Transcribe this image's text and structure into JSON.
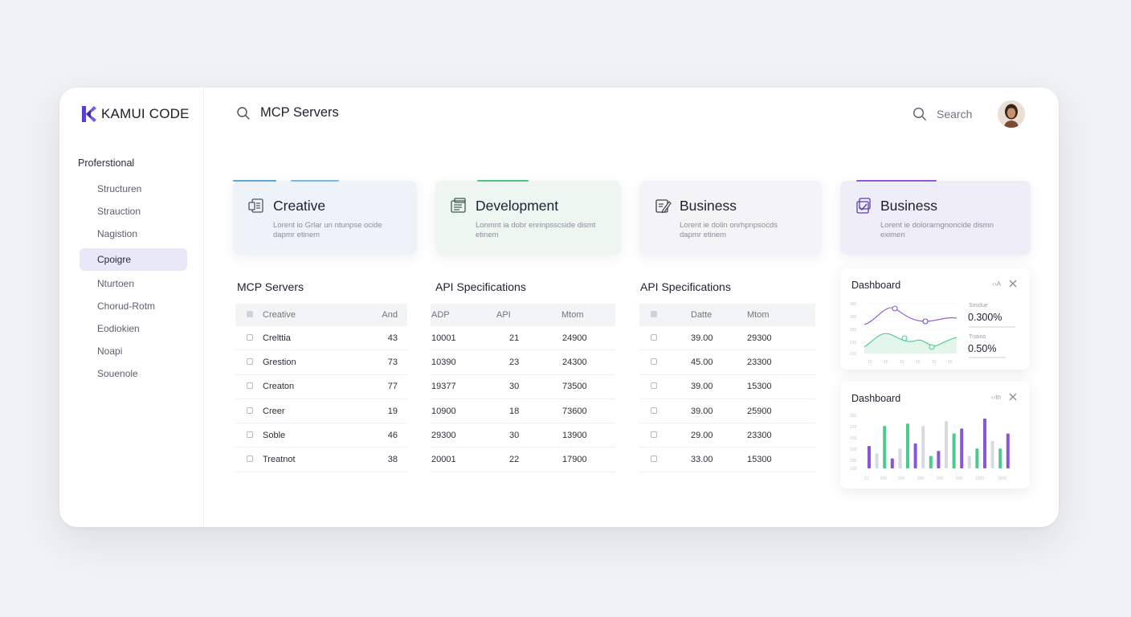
{
  "brand": {
    "name": "KAMUI CODE"
  },
  "sidebar": {
    "section": "Proferstional",
    "items": [
      {
        "label": "Structuren",
        "active": false
      },
      {
        "label": "Strauction",
        "active": false
      },
      {
        "label": "Nagistion",
        "active": false
      },
      {
        "label": "Cpoigre",
        "active": true
      },
      {
        "label": "Nturtoen",
        "active": false
      },
      {
        "label": "Chorud-Rotm",
        "active": false
      },
      {
        "label": "Eodiokien",
        "active": false
      },
      {
        "label": "Noapi",
        "active": false
      },
      {
        "label": "Souenole",
        "active": false
      }
    ]
  },
  "header": {
    "title": "MCP Servers",
    "search_label": "Search"
  },
  "cards": [
    {
      "title": "Creative",
      "desc": "Lorent io Grlar un ntunpse ocide dapmr etinem",
      "color": "#5aa6e0"
    },
    {
      "title": "Development",
      "desc": "Lonmnt ia dobr enrinpsscside dismt etinem",
      "color": "#4fc38a"
    },
    {
      "title": "Business",
      "desc": "Lorent ie dolin onrhpnpsocds dapmr etinem",
      "color": "#c9cbd2"
    },
    {
      "title": "Business",
      "desc": "Lorent ie dolorarngnoncide dismn eximen",
      "color": "#8e5ad8"
    }
  ],
  "tables": [
    {
      "title": "MCP Servers",
      "headers": [
        "",
        "Creative",
        "And"
      ],
      "rows": [
        [
          "",
          "Crelttia",
          "43"
        ],
        [
          "",
          "Grestion",
          "73"
        ],
        [
          "",
          "Creaton",
          "77"
        ],
        [
          "",
          "Creer",
          "19"
        ],
        [
          "",
          "Soble",
          "46"
        ],
        [
          "",
          "Treatnot",
          "38"
        ]
      ]
    },
    {
      "title": "API Specifications",
      "headers": [
        "ADP",
        "API",
        "Mtom"
      ],
      "rows": [
        [
          "10001",
          "21",
          "24900"
        ],
        [
          "10390",
          "23",
          "24300"
        ],
        [
          "19377",
          "30",
          "73500"
        ],
        [
          "10900",
          "18",
          "73600"
        ],
        [
          "29300",
          "30",
          "13900"
        ],
        [
          "20001",
          "22",
          "17900"
        ]
      ]
    },
    {
      "title": "API Specifications",
      "headers": [
        "",
        "Datte",
        "Mtom"
      ],
      "rows": [
        [
          "",
          "39.00",
          "29300"
        ],
        [
          "",
          "45.00",
          "23300"
        ],
        [
          "",
          "39.00",
          "15300"
        ],
        [
          "",
          "39.00",
          "25900"
        ],
        [
          "",
          "29.00",
          "23300"
        ],
        [
          "",
          "33.00",
          "15300"
        ]
      ]
    }
  ],
  "dashboards": [
    {
      "title": "Dashboard",
      "ctrl": "‹›A",
      "stats": [
        {
          "label": "Sosdue",
          "value": "0.300%"
        },
        {
          "label": "Tnaino",
          "value": "0.50%"
        }
      ]
    },
    {
      "title": "Dashboard",
      "ctrl": "‹›tn",
      "bars": [
        0.45,
        0.3,
        0.85,
        0.2,
        0.4,
        0.9,
        0.5,
        0.85,
        0.25,
        0.35,
        0.95,
        0.7,
        0.8,
        0.25,
        0.4,
        1.0,
        0.55,
        0.4,
        0.7
      ]
    }
  ],
  "colors": {
    "accent": "#6b46d4",
    "purple": "#8a55d6",
    "green": "#4cc98c",
    "gray": "#d8dae0"
  }
}
